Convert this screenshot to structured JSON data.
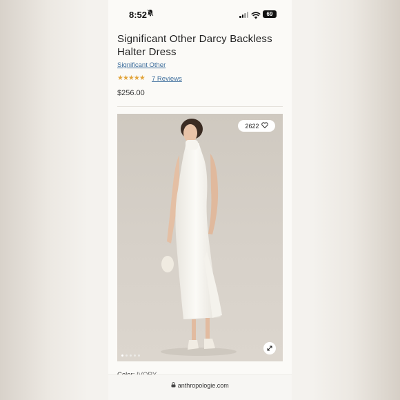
{
  "status_bar": {
    "time": "8:52",
    "battery": "69"
  },
  "product": {
    "title": "Significant Other Darcy Backless Halter Dress",
    "brand": "Significant Other",
    "rating_stars": "★★★★★",
    "rating": 4.5,
    "reviews": "7 Reviews",
    "price": "$256.00"
  },
  "gallery": {
    "likes_count": "2622",
    "slide_count": 5,
    "active_slide": 1
  },
  "color": {
    "label": "Color:",
    "value": "IVORY"
  },
  "browser": {
    "url": "anthropologie.com"
  },
  "colors": {
    "link": "#3b6c9b",
    "star": "#e2a43a",
    "text": "#1f1f1f"
  }
}
